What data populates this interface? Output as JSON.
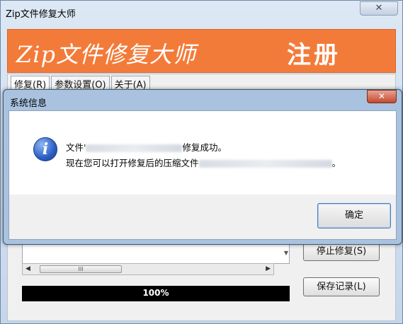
{
  "main_window": {
    "title": "Zip文件修复大师",
    "close_glyph": "✕",
    "banner_title": "Zip文件修复大师",
    "banner_register": "注册"
  },
  "tabs": [
    {
      "label": "修复(R)"
    },
    {
      "label": "参数设置(O)"
    },
    {
      "label": "关于(A)"
    }
  ],
  "scrollbar": {
    "left_arrow": "◀",
    "right_arrow": "▶",
    "thumb_grip": "III",
    "down_arrow": "▼"
  },
  "progress": {
    "percent": 100,
    "text": "100%"
  },
  "buttons": {
    "stop_repair": "停止修复(S)",
    "save_log": "保存记录(L)"
  },
  "dialog": {
    "title": "系统信息",
    "close_glyph": "✕",
    "icon": "info-icon",
    "msg_line1_prefix": "文件'",
    "msg_line1_suffix": "修复成功。",
    "msg_line2_prefix": "现在您可以打开修复后的压缩文件",
    "msg_line2_suffix": "。",
    "ok_label": "确定"
  },
  "colors": {
    "banner": "#f37b3a",
    "dialog_frame": "#a9c2e0",
    "close_red": "#c24a30"
  }
}
